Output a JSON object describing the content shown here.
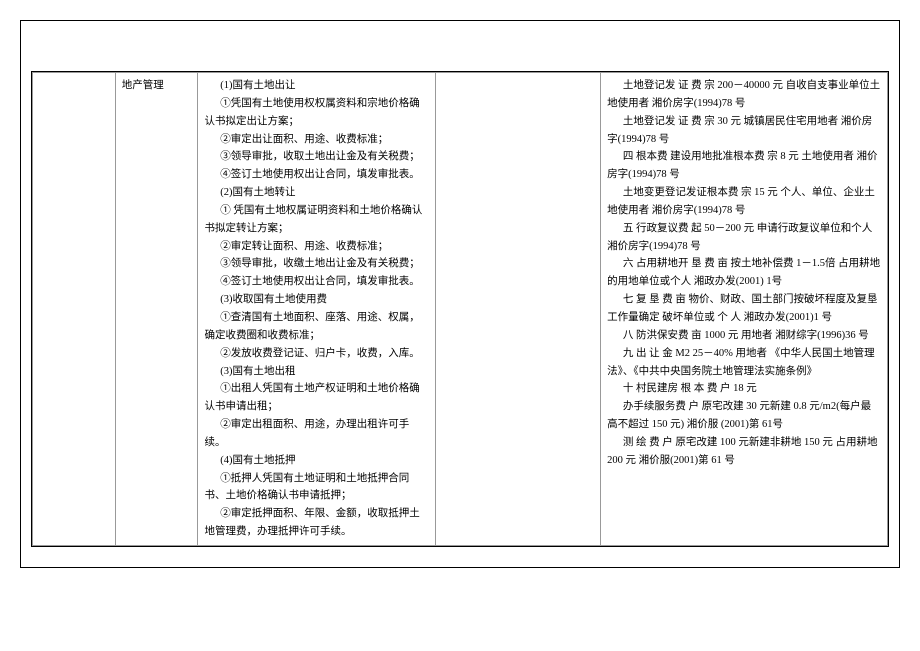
{
  "category": "地产管理",
  "leftColumn": {
    "items": [
      "(1)国有土地出让",
      "①凭国有土地使用权权属资料和宗地价格确认书拟定出让方案；",
      "②审定出让面积、用途、收费标准；",
      "③领导审批，收取土地出让金及有关税费；",
      "④签订土地使用权出让合同，填发审批表。",
      "(2)国有土地转让",
      "① 凭国有土地权属证明资料和土地价格确认书拟定转让方案；",
      "②审定转让面积、用途、收费标准；",
      "③领导审批，收缴土地出让金及有关税费；",
      "④签订土地使用权出让合同，填发审批表。",
      "(3)收取国有土地使用费",
      "①查清国有土地面积、座落、用途、权属，确定收费圈和收费标准；",
      "②发放收费登记证、归户卡，收费，入库。",
      "(3)国有土地出租",
      "①出租人凭国有土地产权证明和土地价格确认书申请出租；",
      "②审定出租面积、用途，办理出租许可手续。",
      "(4)国有土地抵押",
      "①抵押人凭国有土地证明和土地抵押合同书、土地价格确认书申请抵押；",
      "②审定抵押面积、年限、金额，收取抵押土地管理费，办理抵押许可手续。"
    ]
  },
  "rightColumn": {
    "items": [
      "土地登记发 证 费 宗 200－40000 元 自收自支事业单位土地使用者 湘价房字(1994)78 号",
      "土地登记发 证 费 宗 30 元 城镇居民住宅用地者 湘价房字(1994)78 号",
      "四 根本费 建设用地批准根本费 宗 8 元 土地使用者 湘价房字(1994)78 号",
      "土地变更登记发证根本费 宗 15 元 个人、单位、企业土地使用者 湘价房字(1994)78 号",
      "五 行政复议费 起 50－200 元 申请行政复议单位和个人 湘价房字(1994)78 号",
      "六 占用耕地开 垦 费 亩 按土地补偿费 1－1.5倍 占用耕地的用地单位或个人 湘政办发(2001) 1号",
      "七 复 垦 费 亩 物价、财政、国土部门按破坏程度及复垦工作量确定 破坏单位或 个 人 湘政办发(2001)1 号",
      "八 防洪保安费 亩 1000 元 用地者 湘财综字(1996)36 号",
      "九 出 让 金 M2 25－40% 用地者 《中华人民国土地管理法》、《中共中央国务院土地管理法实施条例》",
      "十 村民建房 根 本 费 户 18 元",
      "办手续服务费 户 原宅改建 30 元新建 0.8 元/m2(每户最高不超过 150 元) 湘价服 (2001)第 61号",
      "测 绘 费 户 原宅改建 100 元新建非耕地 150 元 占用耕地 200 元 湘价服(2001)第 61 号"
    ]
  }
}
